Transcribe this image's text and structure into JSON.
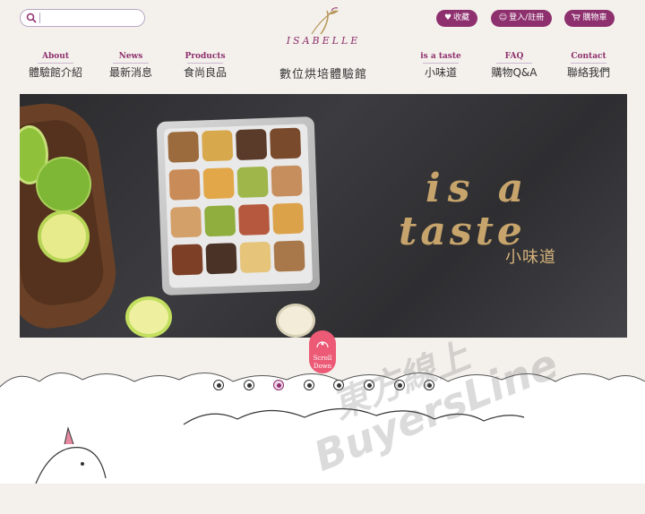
{
  "header": {
    "search": {
      "placeholder": ""
    },
    "buttons": {
      "favorite": "收藏",
      "login": "登入/註冊",
      "cart": "購物車"
    },
    "logo": {
      "brand": "ISABELLE"
    },
    "subtitle": "數位烘培體驗館"
  },
  "nav": [
    {
      "en": "About",
      "zh": "體驗館介紹"
    },
    {
      "en": "News",
      "zh": "最新消息"
    },
    {
      "en": "Products",
      "zh": "食尚良品"
    },
    {
      "en": "is a taste",
      "zh": "小味道"
    },
    {
      "en": "FAQ",
      "zh": "購物Q&A"
    },
    {
      "en": "Contact",
      "zh": "聯絡我們"
    }
  ],
  "hero": {
    "tagline_line1": "is a",
    "tagline_line2": "taste",
    "tagline_zh": "小味道"
  },
  "scroll": {
    "line1": "Scroll",
    "line2": "Down"
  },
  "carousel": {
    "count": 8,
    "active_index": 2
  },
  "watermark": {
    "line1": "東方線上",
    "line2": "BuyersLine"
  },
  "colors": {
    "accent": "#8e2f6e",
    "scroll": "#ec5a76",
    "gold": "#c7a46b"
  }
}
